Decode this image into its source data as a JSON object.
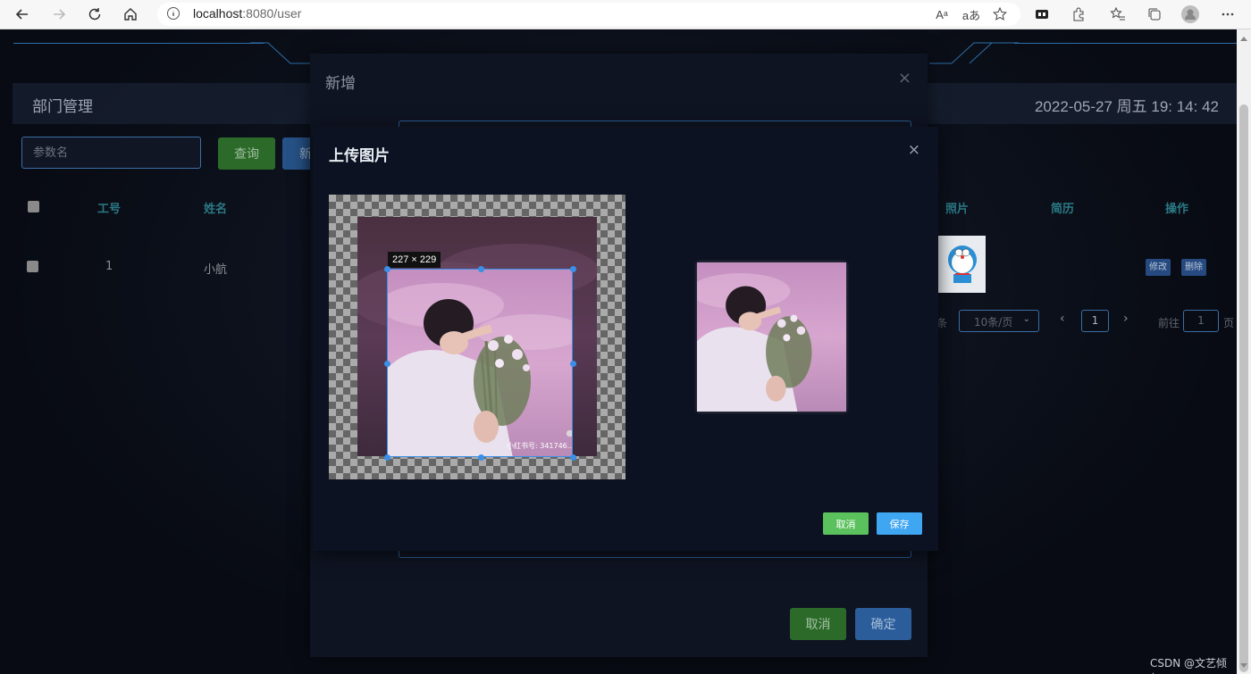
{
  "browser": {
    "url_host": "localhost",
    "url_rest": ":8080/user",
    "read_aloud_label": "Aᵃ",
    "translate_label": "aあ"
  },
  "page": {
    "title": "部门管理",
    "clock": "2022-05-27 周五 19: 14: 42",
    "search_placeholder": "参数名",
    "query_label": "查询",
    "new_label_partial": "新"
  },
  "table": {
    "headers": {
      "id": "工号",
      "name": "姓名",
      "photo": "照片",
      "resume": "简历",
      "actions": "操作"
    },
    "row": {
      "id": "1",
      "name": "小航",
      "edit_label": "修改",
      "delete_label": "删除"
    }
  },
  "pager": {
    "total_suffix": "条",
    "page_size": "10条/页",
    "current_page": "1",
    "goto_label": "前往",
    "goto_value": "1",
    "page_suffix": "页"
  },
  "outer_dialog": {
    "title": "新增",
    "close_glyph": "×",
    "cancel_label": "取消",
    "ok_label": "确定"
  },
  "upload_dialog": {
    "title": "上传图片",
    "close_glyph": "×",
    "crop_size_label": "227 × 229",
    "image_watermark": "小红书号: 341746…",
    "cancel_label": "取消",
    "save_label": "保存"
  },
  "watermark": "CSDN @文艺倾年",
  "colors": {
    "accent_blue": "#3b8fe8",
    "save_blue": "#3fa6f2",
    "cancel_green": "#5ac15c",
    "header_teal": "#2a7a86"
  }
}
